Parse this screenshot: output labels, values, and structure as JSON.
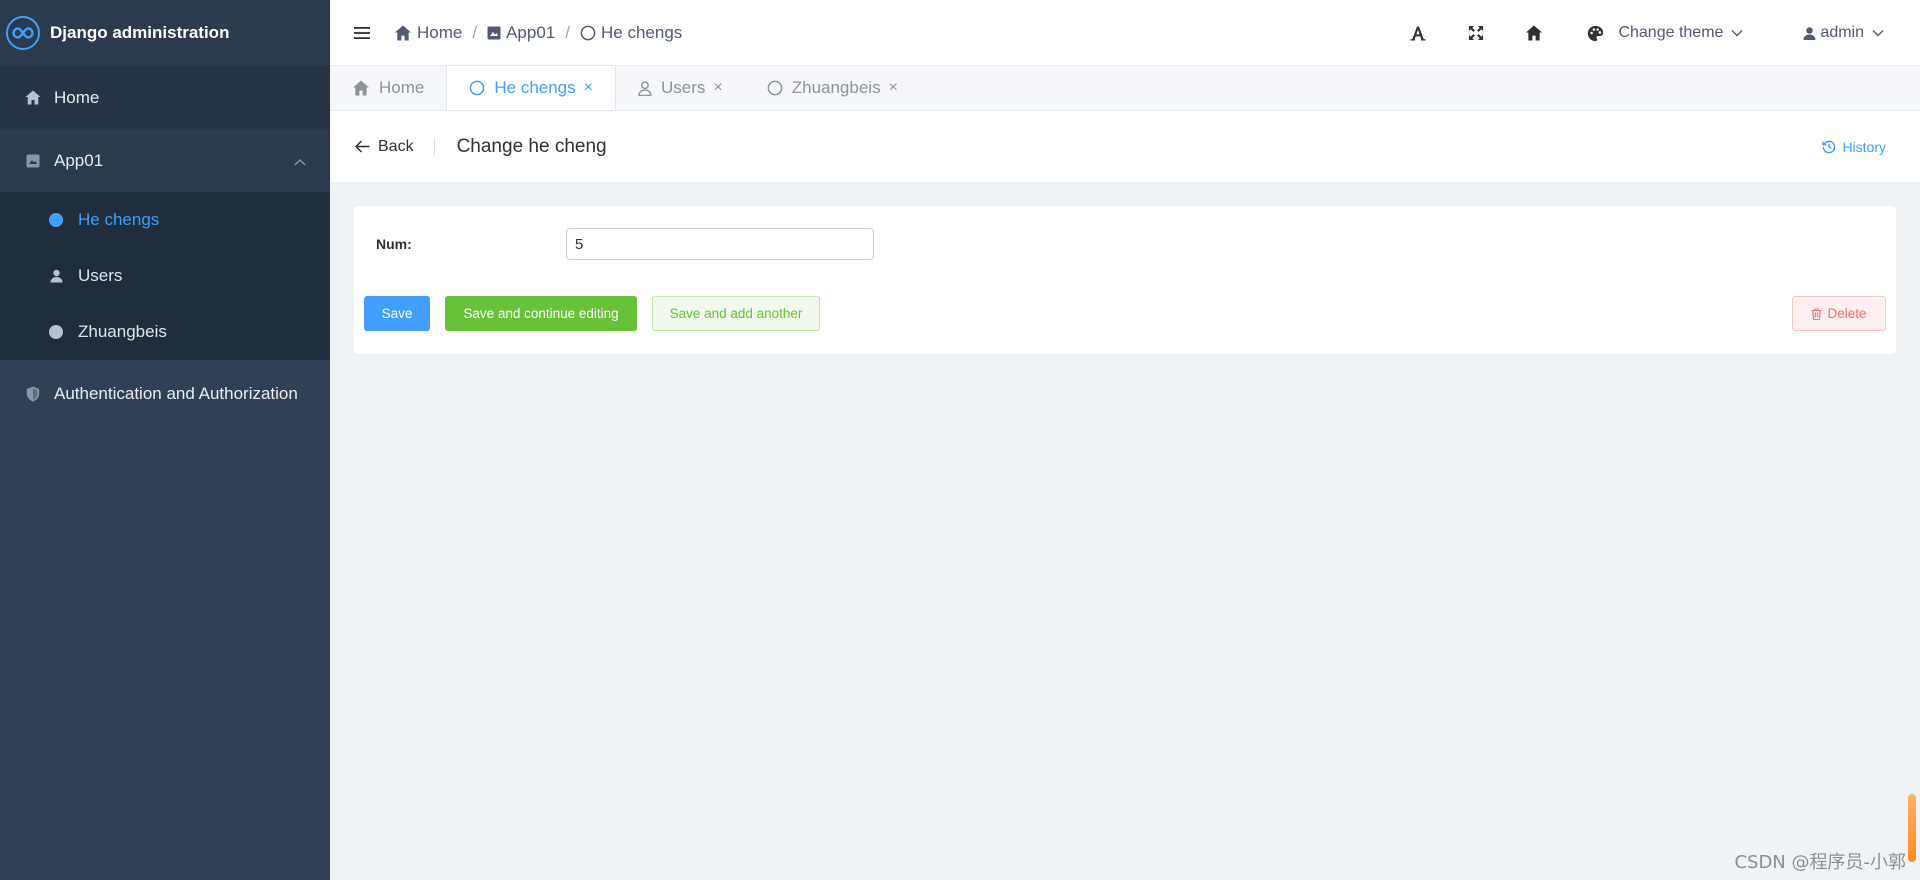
{
  "app": {
    "brand_title": "Django administration"
  },
  "sidebar": {
    "home_label": "Home",
    "app_label": "App01",
    "sub_items": [
      "He chengs",
      "Users",
      "Zhuangbeis"
    ],
    "auth_label": "Authentication and Authorization"
  },
  "header": {
    "breadcrumb": [
      "Home",
      "App01",
      "He chengs"
    ],
    "change_theme_label": "Change theme",
    "user_label": "admin"
  },
  "tabs": [
    {
      "label": "Home",
      "closable": false,
      "active": false
    },
    {
      "label": "He chengs",
      "closable": true,
      "active": true
    },
    {
      "label": "Users",
      "closable": true,
      "active": false
    },
    {
      "label": "Zhuangbeis",
      "closable": true,
      "active": false
    }
  ],
  "tab_close_glyph": "×",
  "page": {
    "back_label": "Back",
    "title": "Change he cheng",
    "history_label": "History"
  },
  "form": {
    "num_label": "Num:",
    "num_value": "5"
  },
  "buttons": {
    "save": "Save",
    "save_continue": "Save and continue editing",
    "save_add": "Save and add another",
    "delete": "Delete"
  },
  "watermark": "CSDN @程序员-小郭",
  "colors": {
    "sidebar_bg": "#304156",
    "accent": "#409eff",
    "success": "#67c23a",
    "danger": "#f56c6c"
  }
}
